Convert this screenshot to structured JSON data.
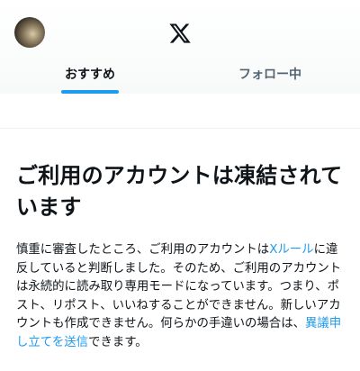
{
  "header": {
    "avatar_icon": "user-avatar",
    "logo_icon": "x-logo-icon"
  },
  "tabs": [
    {
      "label": "おすすめ",
      "active": true
    },
    {
      "label": "フォロー中",
      "active": false
    }
  ],
  "notice": {
    "title": "ご利用のアカウントは凍結されています",
    "body_1": "慎重に審査したところ、ご利用のアカウントは",
    "link_rules": "Xルール",
    "body_2": "に違反していると判断しました。そのため、ご利用のアカウントは永続的に読み取り専用モードになっています。つまり、ポスト、リポスト、いいねすることができません。新しいアカウントも作成できません。何らかの手違いの場合は、",
    "link_appeal": "異議申し立てを送信",
    "body_3": "できます。"
  },
  "colors": {
    "accent": "#1d9bf0",
    "text_primary": "#0f1419",
    "text_secondary": "#536471"
  }
}
